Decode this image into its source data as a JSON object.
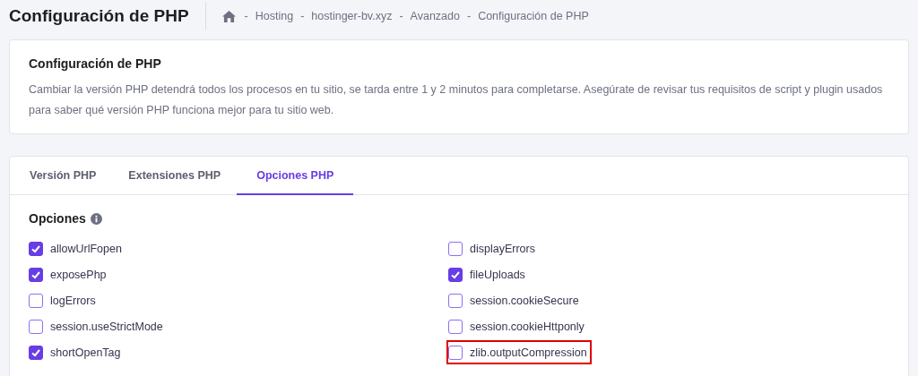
{
  "page_title": "Configuración de PHP",
  "breadcrumb": [
    "Hosting",
    "hostinger-bv.xyz",
    "Avanzado",
    "Configuración de PHP"
  ],
  "breadcrumb_separator": "-",
  "info_card": {
    "title": "Configuración de PHP",
    "text": "Cambiar la versión PHP detendrá todos los procesos en tu sitio, se tarda entre 1 y 2 minutos para completarse. Asegúrate de revisar tus requisitos de script y plugin usados para saber qué versión PHP funciona mejor para tu sitio web."
  },
  "tabs": [
    {
      "label": "Versión PHP",
      "selected": false
    },
    {
      "label": "Extensiones PHP",
      "selected": false
    },
    {
      "label": "Opciones PHP",
      "selected": true
    }
  ],
  "options_title": "Opciones",
  "options": [
    {
      "label": "allowUrlFopen",
      "checked": true,
      "highlighted": false
    },
    {
      "label": "displayErrors",
      "checked": false,
      "highlighted": false
    },
    {
      "label": "exposePhp",
      "checked": true,
      "highlighted": false
    },
    {
      "label": "fileUploads",
      "checked": true,
      "highlighted": false
    },
    {
      "label": "logErrors",
      "checked": false,
      "highlighted": false
    },
    {
      "label": "session.cookieSecure",
      "checked": false,
      "highlighted": false
    },
    {
      "label": "session.useStrictMode",
      "checked": false,
      "highlighted": false
    },
    {
      "label": "session.cookieHttponly",
      "checked": false,
      "highlighted": false
    },
    {
      "label": "shortOpenTag",
      "checked": true,
      "highlighted": false
    },
    {
      "label": "zlib.outputCompression",
      "checked": false,
      "highlighted": true
    }
  ]
}
